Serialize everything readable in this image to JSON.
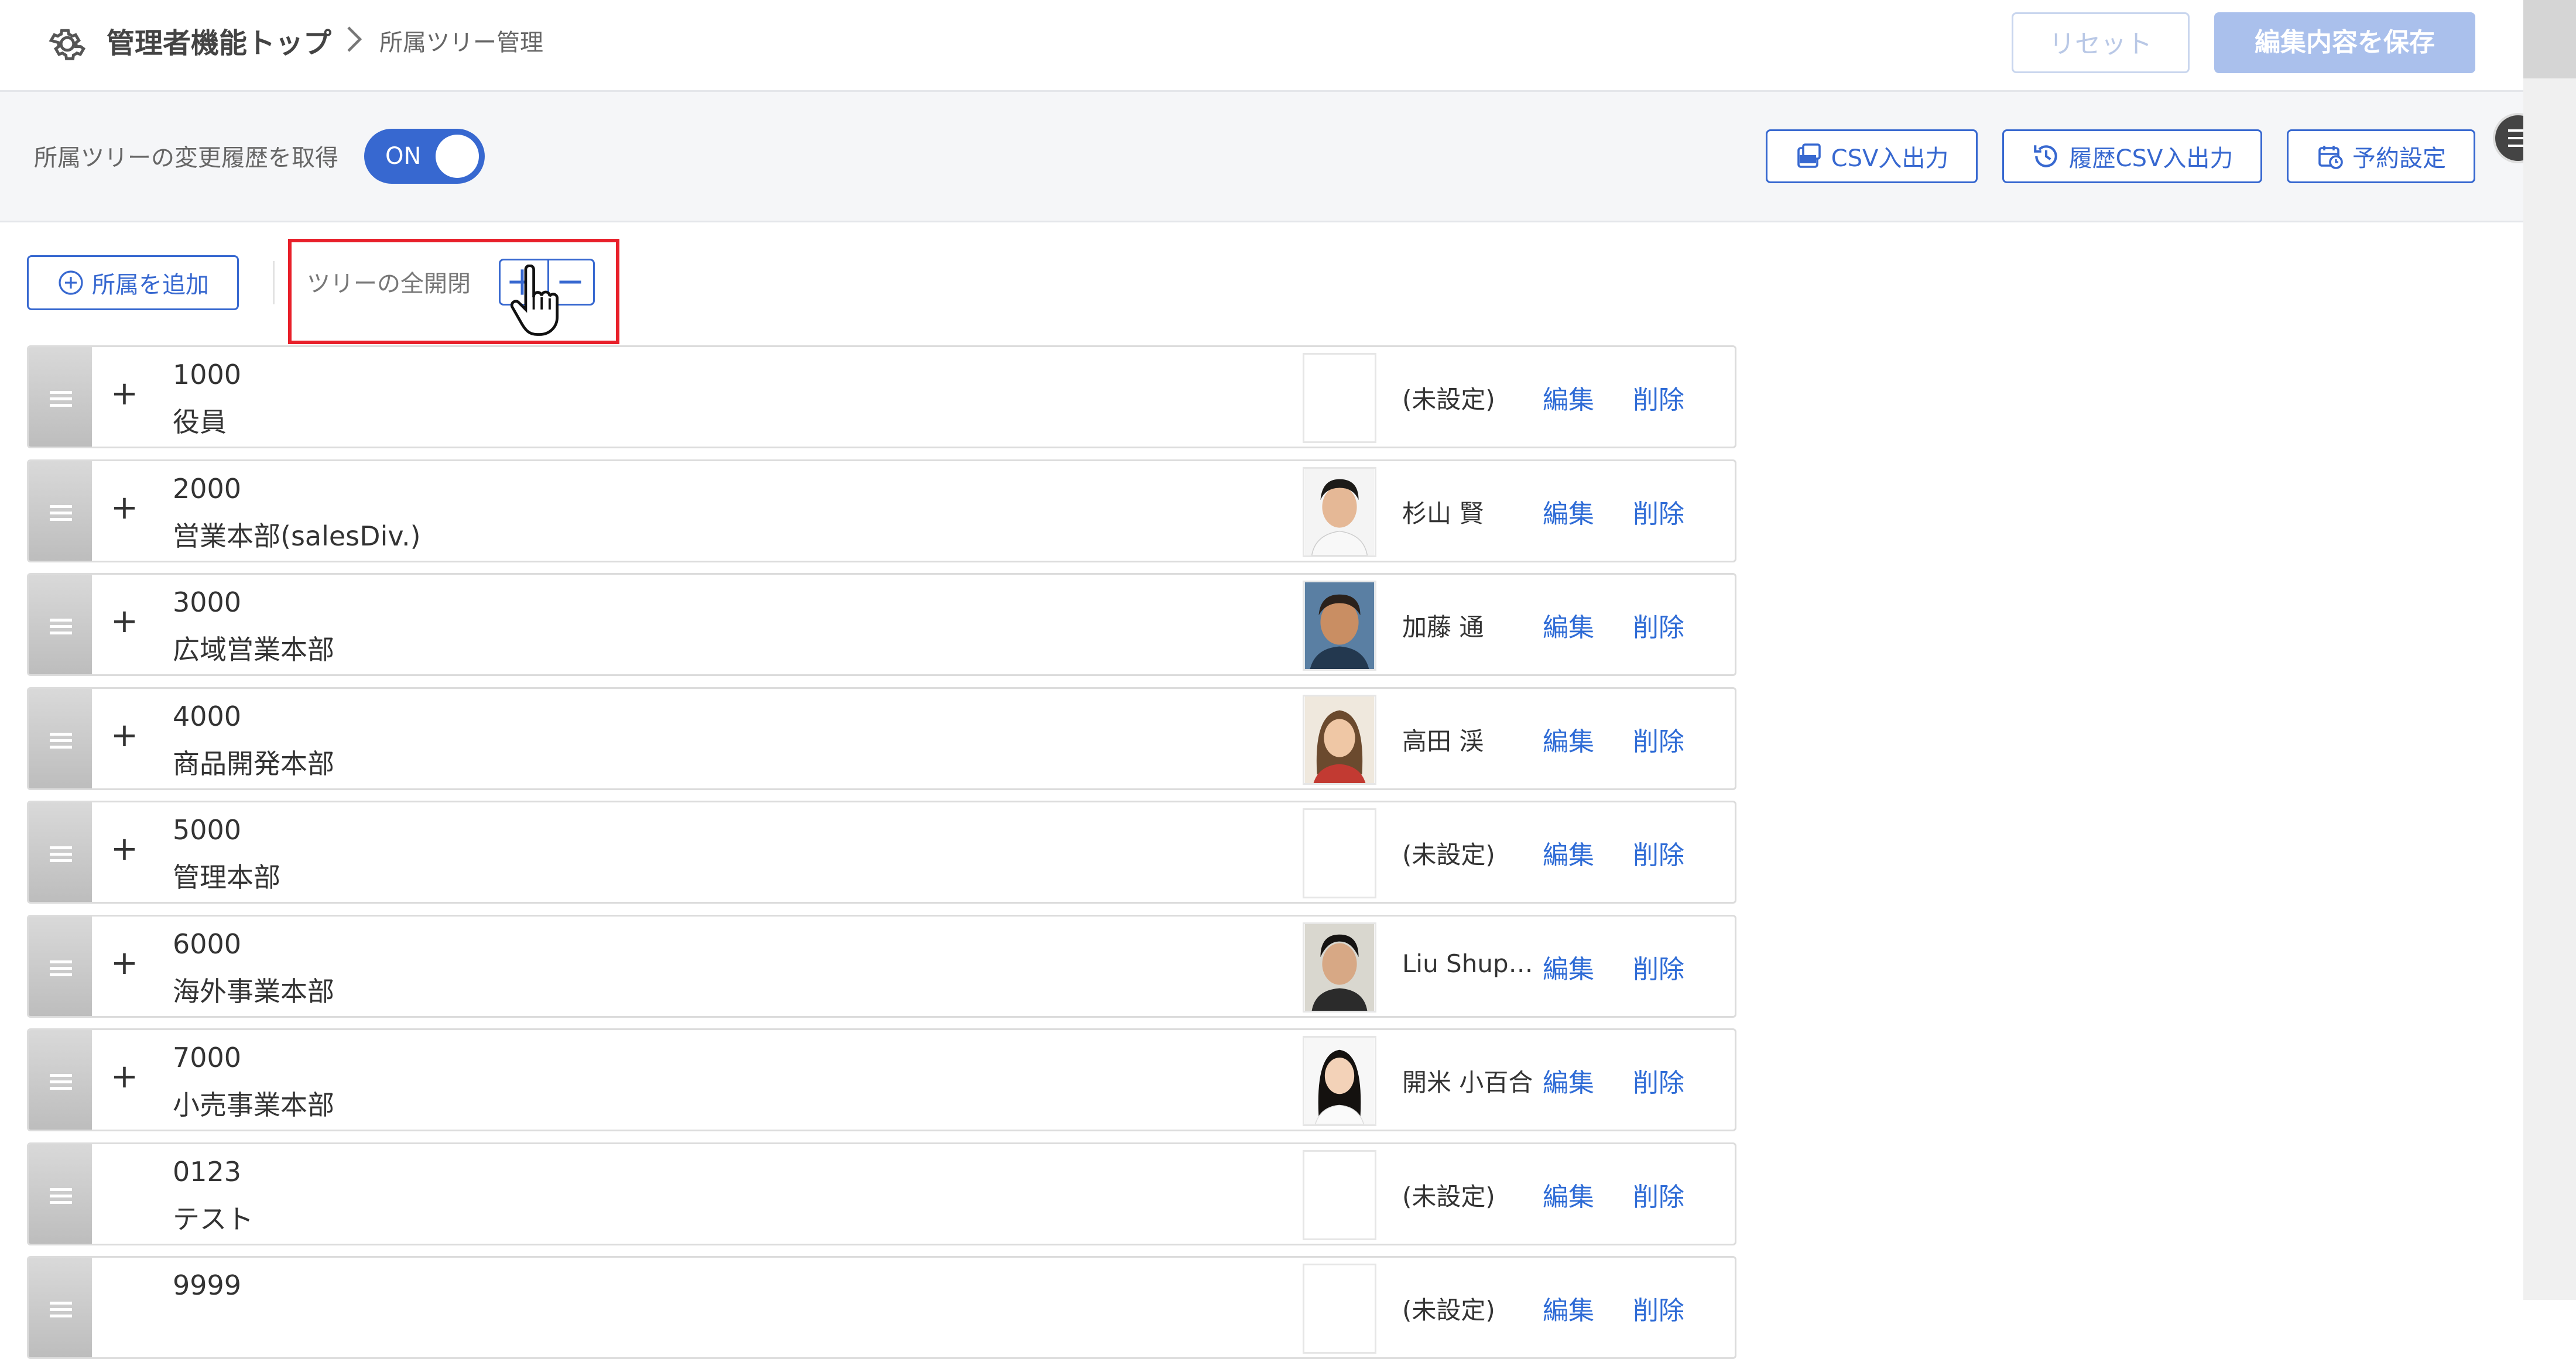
{
  "header": {
    "breadcrumb_main": "管理者機能トップ",
    "breadcrumb_current": "所属ツリー管理",
    "reset_label": "リセット",
    "save_label": "編集内容を保存"
  },
  "toolbar": {
    "history_label": "所属ツリーの変更履歴を取得",
    "toggle_label": "ON",
    "toggle_on": true,
    "csv_label": "CSV入出力",
    "history_csv_label": "履歴CSV入出力",
    "schedule_label": "予約設定"
  },
  "tree_controls": {
    "add_label": "所属を追加",
    "expand_all_label": "ツリーの全開閉",
    "expand_symbol": "+",
    "collapse_symbol": "—"
  },
  "rows": [
    {
      "code": "1000",
      "name": "役員",
      "expand": "+",
      "manager": "(未設定)",
      "photo": "none",
      "edit": "編集",
      "delete": "削除"
    },
    {
      "code": "2000",
      "name": "営業本部(salesDiv.)",
      "expand": "+",
      "manager": "杉山 賢",
      "photo": "male-short-hair",
      "edit": "編集",
      "delete": "削除"
    },
    {
      "code": "3000",
      "name": "広域営業本部",
      "expand": "+",
      "manager": "加藤 通",
      "photo": "male-smiling",
      "edit": "編集",
      "delete": "削除"
    },
    {
      "code": "4000",
      "name": "商品開発本部",
      "expand": "+",
      "manager": "高田 渓",
      "photo": "female-long-hair",
      "edit": "編集",
      "delete": "削除"
    },
    {
      "code": "5000",
      "name": "管理本部",
      "expand": "+",
      "manager": "(未設定)",
      "photo": "none",
      "edit": "編集",
      "delete": "削除"
    },
    {
      "code": "6000",
      "name": "海外事業本部",
      "expand": "+",
      "manager": "Liu Shup…",
      "photo": "male-young",
      "edit": "編集",
      "delete": "削除"
    },
    {
      "code": "7000",
      "name": "小売事業本部",
      "expand": "+",
      "manager": "開米 小百合",
      "photo": "female-dark-hair",
      "edit": "編集",
      "delete": "削除"
    },
    {
      "code": "0123",
      "name": "テスト",
      "expand": "",
      "manager": "(未設定)",
      "photo": "none",
      "edit": "編集",
      "delete": "削除"
    },
    {
      "code": "9999",
      "name": "",
      "expand": "",
      "manager": "(未設定)",
      "photo": "none",
      "edit": "編集",
      "delete": "削除"
    }
  ],
  "colors": {
    "accent": "#3768d0",
    "link": "#2f6cd6",
    "highlight": "#e8202a",
    "save_disabled": "#aac0ec"
  }
}
